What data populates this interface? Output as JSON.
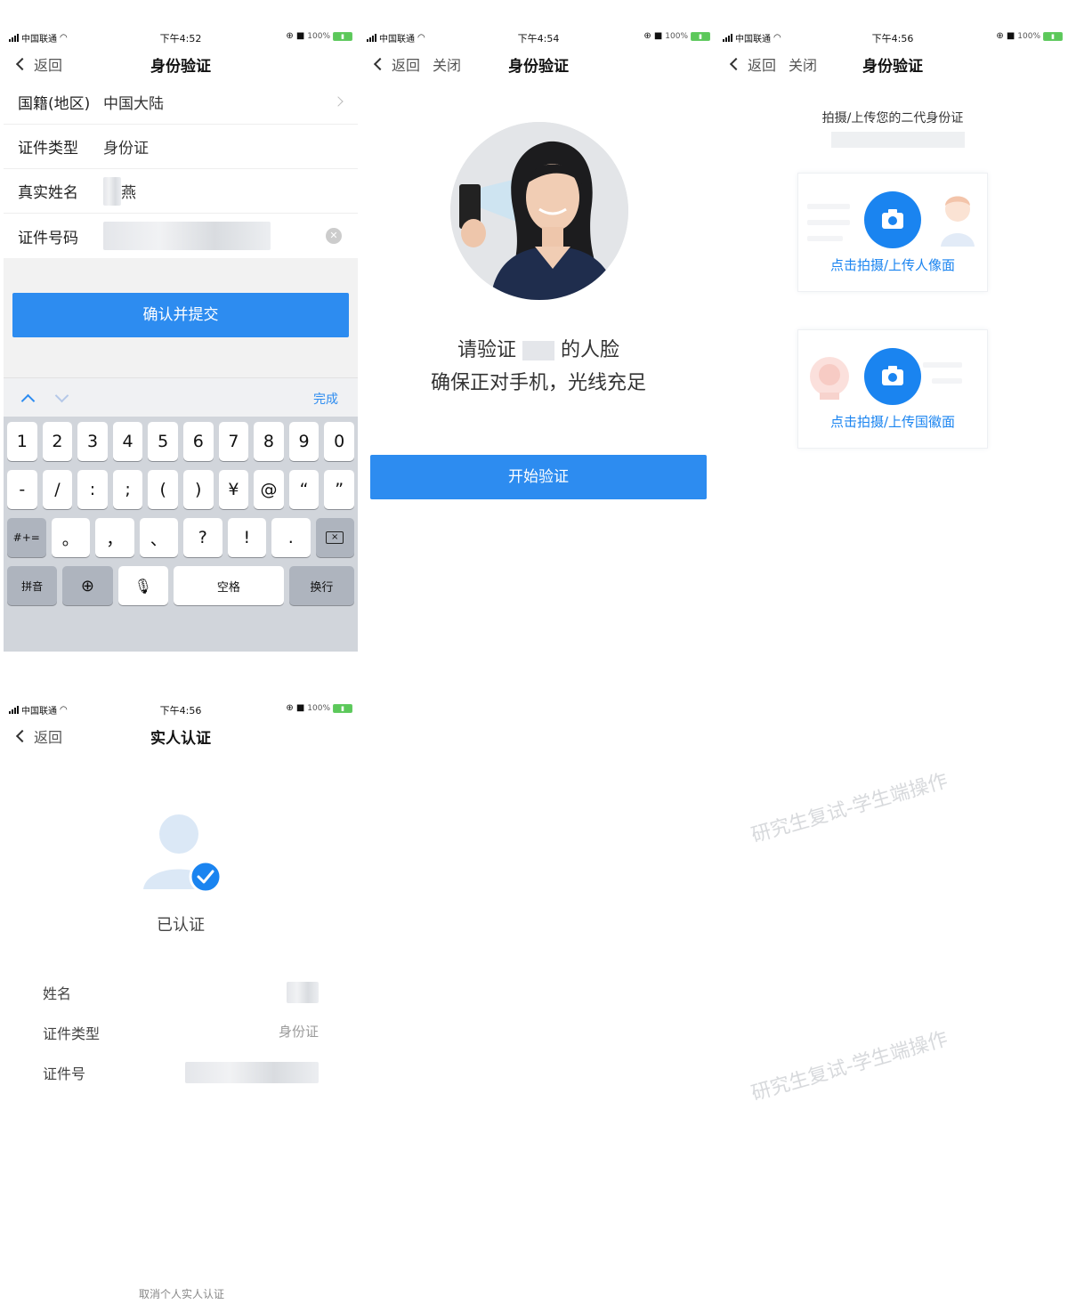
{
  "status": {
    "carrier": "中国联通",
    "battery": "100%",
    "times": [
      "下午4:52",
      "下午4:54",
      "下午4:56",
      "下午4:56"
    ]
  },
  "nav": {
    "back": "返回",
    "close": "关闭"
  },
  "screen1": {
    "title": "身份验证",
    "rows": [
      {
        "label": "国籍(地区)",
        "value": "中国大陆"
      },
      {
        "label": "证件类型",
        "value": "身份证"
      },
      {
        "label": "真实姓名",
        "value": "燕"
      },
      {
        "label": "证件号码",
        "value": ""
      }
    ],
    "submit": "确认并提交",
    "keyboard_done": "完成",
    "keys_row1": [
      "1",
      "2",
      "3",
      "4",
      "5",
      "6",
      "7",
      "8",
      "9",
      "0"
    ],
    "keys_row2": [
      "-",
      "/",
      ":",
      ";",
      "(",
      ")",
      "¥",
      "@",
      "“",
      "”"
    ],
    "keys_row3": [
      "#+=",
      "。",
      "，",
      "、",
      "?",
      "!",
      "."
    ],
    "pinyin": "拼音",
    "space": "空格",
    "return": "换行"
  },
  "screen2": {
    "title": "身份验证",
    "line1_pre": "请验证",
    "line1_post": "的人脸",
    "line2": "确保正对手机，光线充足",
    "start": "开始验证"
  },
  "screen3": {
    "title": "身份验证",
    "hint": "拍摄/上传您的二代身份证",
    "portrait_label": "点击拍摄/上传人像面",
    "emblem_label": "点击拍摄/上传国徽面"
  },
  "screen4": {
    "title": "实人认证",
    "verified": "已认证",
    "name_label": "姓名",
    "id_type_label": "证件类型",
    "id_type_value": "身份证",
    "id_no_label": "证件号",
    "cancel": "取消个人实人认证"
  },
  "watermark": "研究生复试-学生端操作",
  "colors": {
    "primary": "#2d8cf0",
    "camera": "#1a84f0"
  },
  "icons": [
    "back-chevron-icon",
    "chevron-right-icon",
    "clear-icon",
    "camera-icon",
    "globe-icon",
    "mic-icon",
    "backspace-icon",
    "check-icon",
    "user-avatar-icon"
  ]
}
